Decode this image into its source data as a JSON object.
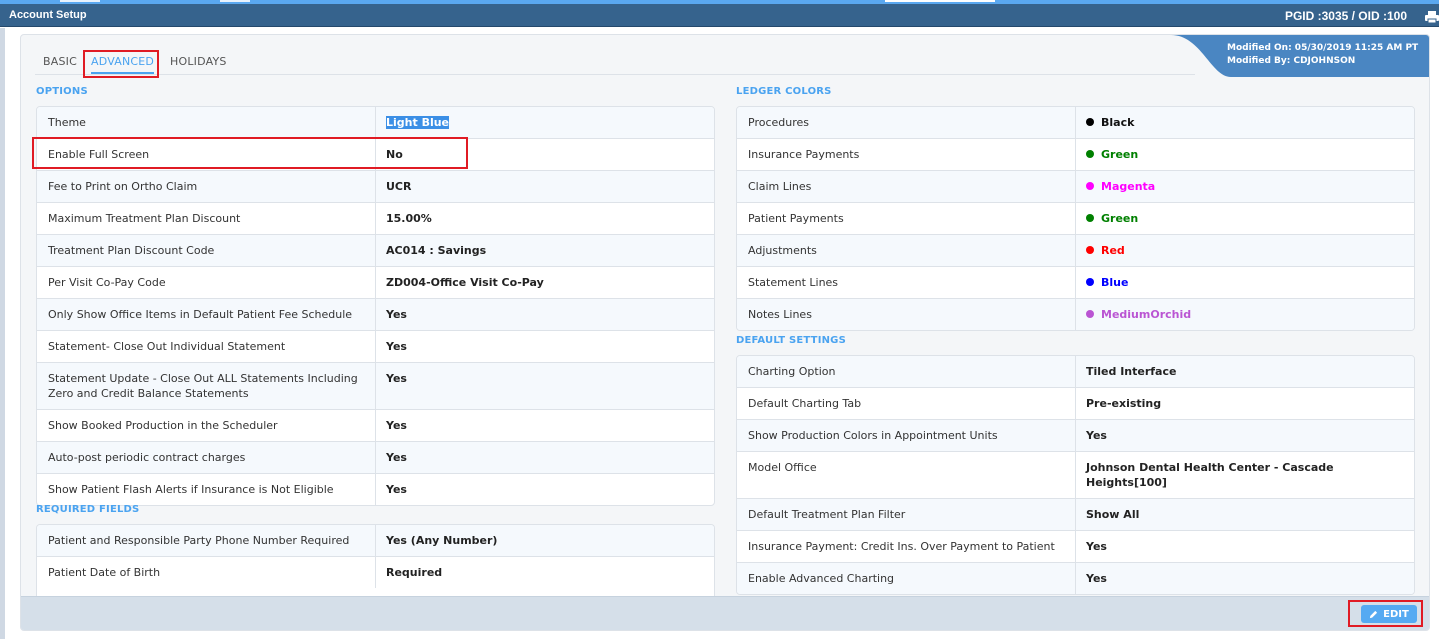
{
  "window": {
    "title": "Account Setup",
    "ids": "PGID :3035  /  OID :100"
  },
  "tabs": [
    {
      "label": "BASIC",
      "active": false
    },
    {
      "label": "ADVANCED",
      "active": true
    },
    {
      "label": "HOLIDAYS",
      "active": false
    }
  ],
  "modified": {
    "on": "Modified On: 05/30/2019 11:25 AM PT",
    "by": "Modified By: CDJOHNSON"
  },
  "options": {
    "title": "OPTIONS",
    "rows": [
      {
        "label": "Theme",
        "value": "Light Blue",
        "selected": true
      },
      {
        "label": "Enable Full Screen",
        "value": "No"
      },
      {
        "label": "Fee to Print on Ortho Claim",
        "value": "UCR"
      },
      {
        "label": "Maximum Treatment Plan Discount",
        "value": "15.00%"
      },
      {
        "label": "Treatment Plan Discount Code",
        "value": "AC014 : Savings"
      },
      {
        "label": "Per Visit Co-Pay Code",
        "value": "ZD004-Office Visit Co-Pay"
      },
      {
        "label": "Only Show Office Items in Default Patient Fee Schedule",
        "value": "Yes"
      },
      {
        "label": "Statement- Close Out Individual Statement",
        "value": "Yes"
      },
      {
        "label": "Statement Update - Close Out ALL Statements Including Zero and Credit Balance Statements",
        "value": "Yes"
      },
      {
        "label": "Show Booked Production in the Scheduler",
        "value": "Yes"
      },
      {
        "label": "Auto-post periodic contract charges",
        "value": "Yes"
      },
      {
        "label": "Show Patient Flash Alerts if Insurance is Not Eligible",
        "value": "Yes"
      }
    ]
  },
  "required_fields": {
    "title": "REQUIRED FIELDS",
    "rows": [
      {
        "label": "Patient and Responsible Party Phone Number Required",
        "value": "Yes (Any Number)"
      },
      {
        "label": "Patient Date of Birth",
        "value": "Required"
      }
    ]
  },
  "ledger_colors": {
    "title": "LEDGER COLORS",
    "rows": [
      {
        "label": "Procedures",
        "value": "Black",
        "color": "#000000"
      },
      {
        "label": "Insurance Payments",
        "value": "Green",
        "color": "#008000"
      },
      {
        "label": "Claim Lines",
        "value": "Magenta",
        "color": "#ff00ff"
      },
      {
        "label": "Patient Payments",
        "value": "Green",
        "color": "#008000"
      },
      {
        "label": "Adjustments",
        "value": "Red",
        "color": "#ff0000"
      },
      {
        "label": "Statement Lines",
        "value": "Blue",
        "color": "#0000ff"
      },
      {
        "label": "Notes Lines",
        "value": "MediumOrchid",
        "color": "#ba55d3"
      }
    ]
  },
  "default_settings": {
    "title": "DEFAULT SETTINGS",
    "rows": [
      {
        "label": "Charting Option",
        "value": "Tiled Interface"
      },
      {
        "label": "Default Charting Tab",
        "value": "Pre-existing"
      },
      {
        "label": "Show Production Colors in Appointment Units",
        "value": "Yes"
      },
      {
        "label": "Model Office",
        "value": "Johnson Dental Health Center - Cascade Heights[100]"
      },
      {
        "label": "Default Treatment Plan Filter",
        "value": "Show All"
      },
      {
        "label": "Insurance Payment: Credit Ins. Over Payment to Patient",
        "value": "Yes"
      },
      {
        "label": "Enable Advanced Charting",
        "value": "Yes"
      }
    ]
  },
  "footer": {
    "edit_label": "EDIT"
  },
  "colors": {
    "accent": "#4aa3f0",
    "titlebar": "#36638d",
    "annotation": "#e01b24"
  }
}
